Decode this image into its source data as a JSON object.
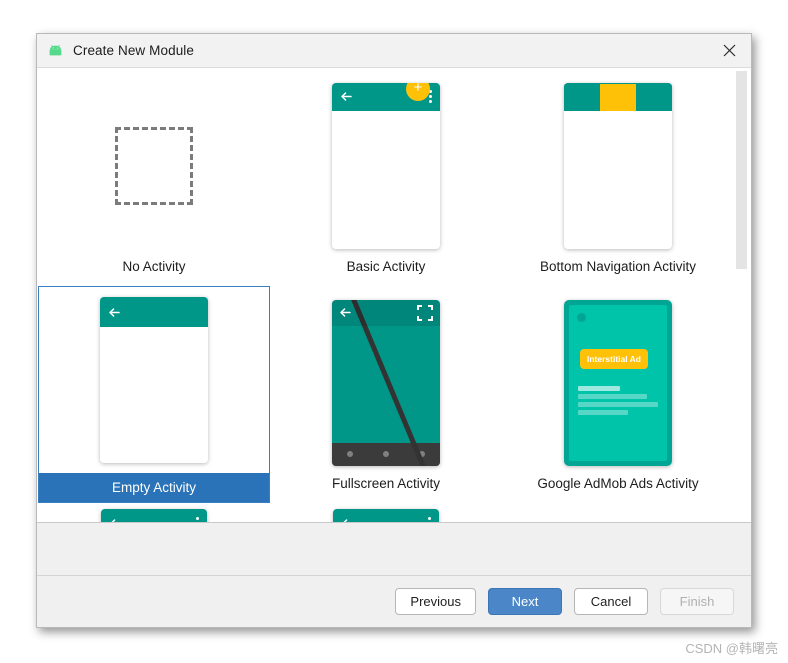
{
  "window": {
    "title": "Create New Module",
    "app_icon": "android-robot-icon",
    "close_icon": "close-icon"
  },
  "gallery": {
    "templates": [
      {
        "label": "No Activity",
        "thumb": "dashed-placeholder"
      },
      {
        "label": "Basic Activity",
        "thumb": "appbar-with-fab"
      },
      {
        "label": "Bottom Navigation Activity",
        "thumb": "appbar-with-bottom-nav"
      },
      {
        "label": "Empty Activity",
        "thumb": "appbar-only",
        "selected": true
      },
      {
        "label": "Fullscreen Activity",
        "thumb": "fullscreen-immersive"
      },
      {
        "label": "Google AdMob Ads Activity",
        "thumb": "admob-interstitial"
      }
    ],
    "admob": {
      "badge_label": "Interstitial Ad"
    },
    "icons": {
      "back": "back-arrow-icon",
      "overflow": "overflow-menu-icon",
      "fab_plus": "plus-icon",
      "expand": "expand-fullscreen-icon"
    }
  },
  "footer": {
    "previous_label": "Previous",
    "next_label": "Next",
    "cancel_label": "Cancel",
    "finish_label": "Finish"
  },
  "colors": {
    "teal": "#009688",
    "amber": "#FFC107",
    "selection_blue": "#2a73b8",
    "admob_teal": "#00c4aa"
  },
  "watermark": {
    "text": "CSDN @韩曙亮"
  }
}
